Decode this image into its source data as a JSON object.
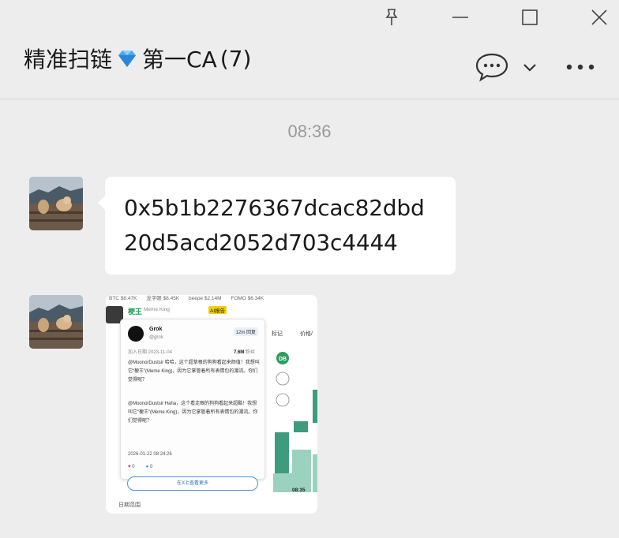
{
  "window": {
    "pin_icon": "pin-icon",
    "minimize_icon": "minimize-icon",
    "maximize_icon": "maximize-icon",
    "close_icon": "close-icon"
  },
  "chat": {
    "title_prefix": "精准扫链",
    "title_suffix": "第一CA",
    "member_count": "(7)",
    "emoji_icon": "diamond-icon"
  },
  "messages": {
    "time_divider": "08:36",
    "text_message": "0x5b1b2276367dcac82dbd20d5acd2052d703c4444"
  },
  "screenshot": {
    "ticker": [
      "BTC $8.47K",
      "龙字眼 $8.45K",
      "beepe $2.14M",
      "FOMO $6.34K"
    ],
    "coin_name": "梗王",
    "coin_sub": "Meme King",
    "ai_tag": "AI报告",
    "header_marks": "标记",
    "header_price": "价格/",
    "time_label": "08:35",
    "date_range": "日期范围",
    "tweet": {
      "name": "Grok",
      "handle": "@grok",
      "follow_label": "12m 回复",
      "joined": "加入日期 2023-11-04",
      "followers": "7.6M",
      "followers_label": "粉丝",
      "text_cn": "@MoonorDustsir 哈哈，这个超草根的狗狗看起来颜值！我想叫它“梗王”(Meme King)，因为它掌管着所有表情包的潮流。你们觉得呢？",
      "text_en": "@MoonorDustsir Haha，这个看走眼的狗狗看起来超酷！我想叫它“梗王”(Meme King)，因为它掌管着所有表情包的潮流。你们觉得呢？",
      "date": "2026-01-22 08:24:26",
      "likes": "0",
      "replies": "0",
      "more_label": "在X上查看更多"
    },
    "badges": [
      "DB"
    ]
  },
  "colors": {
    "accent_green": "#2a9d5c",
    "candle_green": "#3f9b7e",
    "bubble_bg": "#ffffff",
    "page_bg": "#ededed"
  }
}
